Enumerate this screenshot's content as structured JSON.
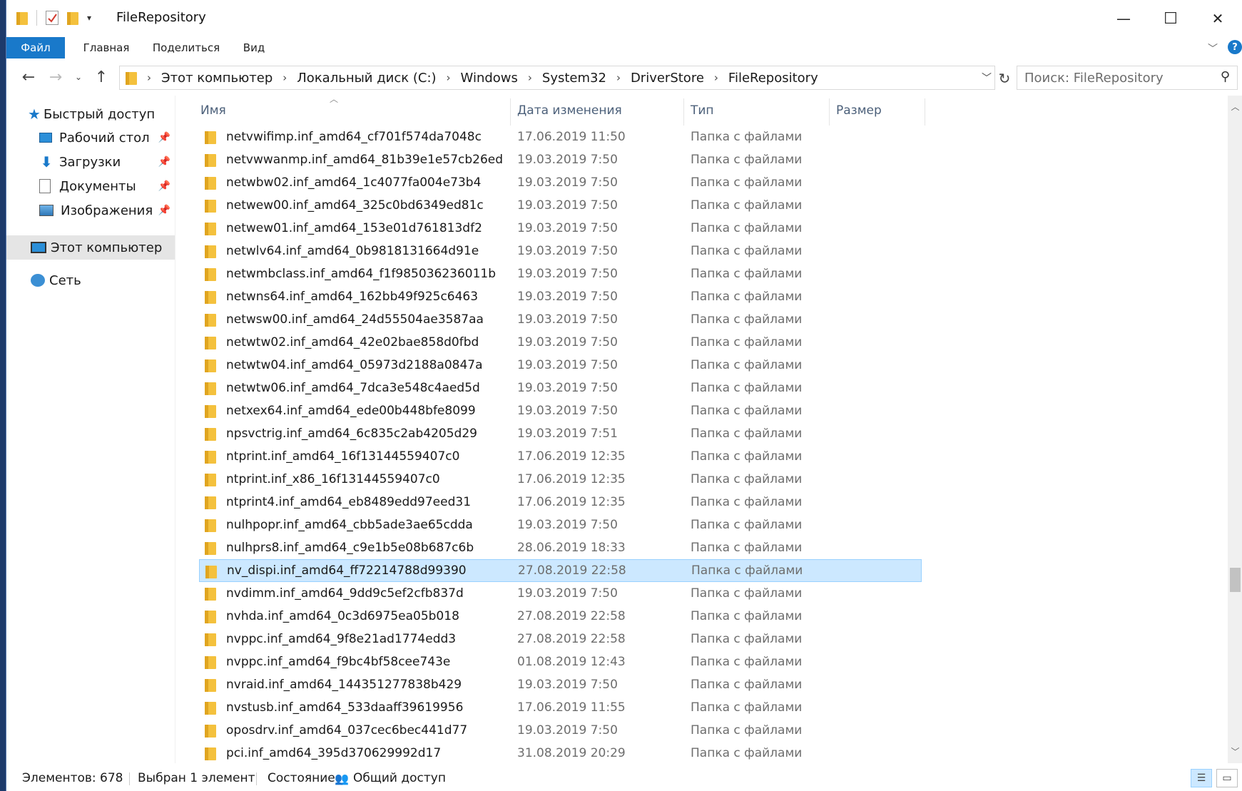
{
  "window": {
    "title": "FileRepository",
    "controls": {
      "minimize": "—",
      "maximize": "☐",
      "close": "✕"
    }
  },
  "ribbon": {
    "tabs": [
      "Файл",
      "Главная",
      "Поделиться",
      "Вид"
    ],
    "help": "?"
  },
  "address": {
    "crumbs": [
      "Этот компьютер",
      "Локальный диск (C:)",
      "Windows",
      "System32",
      "DriverStore",
      "FileRepository"
    ],
    "search_placeholder": "Поиск: FileRepository"
  },
  "nav": {
    "quick_access": "Быстрый доступ",
    "items": [
      {
        "label": "Рабочий стол",
        "icon": "desktop-icon",
        "pinned": true
      },
      {
        "label": "Загрузки",
        "icon": "downloads-icon",
        "pinned": true
      },
      {
        "label": "Документы",
        "icon": "documents-icon",
        "pinned": true
      },
      {
        "label": "Изображения",
        "icon": "pictures-icon",
        "pinned": true
      }
    ],
    "this_pc": "Этот компьютер",
    "network": "Сеть"
  },
  "columns": {
    "name": "Имя",
    "date": "Дата изменения",
    "type": "Тип",
    "size": "Размер"
  },
  "files": [
    {
      "name": "netvwifimp.inf_amd64_cf701f574da7048c",
      "date": "17.06.2019 11:50",
      "type": "Папка с файлами"
    },
    {
      "name": "netvwwanmp.inf_amd64_81b39e1e57cb26ed",
      "date": "19.03.2019 7:50",
      "type": "Папка с файлами"
    },
    {
      "name": "netwbw02.inf_amd64_1c4077fa004e73b4",
      "date": "19.03.2019 7:50",
      "type": "Папка с файлами"
    },
    {
      "name": "netwew00.inf_amd64_325c0bd6349ed81c",
      "date": "19.03.2019 7:50",
      "type": "Папка с файлами"
    },
    {
      "name": "netwew01.inf_amd64_153e01d761813df2",
      "date": "19.03.2019 7:50",
      "type": "Папка с файлами"
    },
    {
      "name": "netwlv64.inf_amd64_0b9818131664d91e",
      "date": "19.03.2019 7:50",
      "type": "Папка с файлами"
    },
    {
      "name": "netwmbclass.inf_amd64_f1f985036236011b",
      "date": "19.03.2019 7:50",
      "type": "Папка с файлами"
    },
    {
      "name": "netwns64.inf_amd64_162bb49f925c6463",
      "date": "19.03.2019 7:50",
      "type": "Папка с файлами"
    },
    {
      "name": "netwsw00.inf_amd64_24d55504ae3587aa",
      "date": "19.03.2019 7:50",
      "type": "Папка с файлами"
    },
    {
      "name": "netwtw02.inf_amd64_42e02bae858d0fbd",
      "date": "19.03.2019 7:50",
      "type": "Папка с файлами"
    },
    {
      "name": "netwtw04.inf_amd64_05973d2188a0847a",
      "date": "19.03.2019 7:50",
      "type": "Папка с файлами"
    },
    {
      "name": "netwtw06.inf_amd64_7dca3e548c4aed5d",
      "date": "19.03.2019 7:50",
      "type": "Папка с файлами"
    },
    {
      "name": "netxex64.inf_amd64_ede00b448bfe8099",
      "date": "19.03.2019 7:50",
      "type": "Папка с файлами"
    },
    {
      "name": "npsvctrig.inf_amd64_6c835c2ab4205d29",
      "date": "19.03.2019 7:51",
      "type": "Папка с файлами"
    },
    {
      "name": "ntprint.inf_amd64_16f13144559407c0",
      "date": "17.06.2019 12:35",
      "type": "Папка с файлами"
    },
    {
      "name": "ntprint.inf_x86_16f13144559407c0",
      "date": "17.06.2019 12:35",
      "type": "Папка с файлами"
    },
    {
      "name": "ntprint4.inf_amd64_eb8489edd97eed31",
      "date": "17.06.2019 12:35",
      "type": "Папка с файлами"
    },
    {
      "name": "nulhpopr.inf_amd64_cbb5ade3ae65cdda",
      "date": "19.03.2019 7:50",
      "type": "Папка с файлами"
    },
    {
      "name": "nulhprs8.inf_amd64_c9e1b5e08b687c6b",
      "date": "28.06.2019 18:33",
      "type": "Папка с файлами"
    },
    {
      "name": "nv_dispi.inf_amd64_ff72214788d99390",
      "date": "27.08.2019 22:58",
      "type": "Папка с файлами",
      "selected": true
    },
    {
      "name": "nvdimm.inf_amd64_9dd9c5ef2cfb837d",
      "date": "19.03.2019 7:50",
      "type": "Папка с файлами"
    },
    {
      "name": "nvhda.inf_amd64_0c3d6975ea05b018",
      "date": "27.08.2019 22:58",
      "type": "Папка с файлами"
    },
    {
      "name": "nvppc.inf_amd64_9f8e21ad1774edd3",
      "date": "27.08.2019 22:58",
      "type": "Папка с файлами"
    },
    {
      "name": "nvppc.inf_amd64_f9bc4bf58cee743e",
      "date": "01.08.2019 12:43",
      "type": "Папка с файлами"
    },
    {
      "name": "nvraid.inf_amd64_144351277838b429",
      "date": "19.03.2019 7:50",
      "type": "Папка с файлами"
    },
    {
      "name": "nvstusb.inf_amd64_533daaff39619956",
      "date": "17.06.2019 11:55",
      "type": "Папка с файлами"
    },
    {
      "name": "oposdrv.inf_amd64_037cec6bec441d77",
      "date": "19.03.2019 7:50",
      "type": "Папка с файлами"
    },
    {
      "name": "pci.inf_amd64_395d370629992d17",
      "date": "31.08.2019 20:29",
      "type": "Папка с файлами"
    }
  ],
  "status": {
    "count": "Элементов: 678",
    "selected": "Выбран 1 элемент",
    "state": "Состояние:",
    "sharing": "Общий доступ"
  },
  "colors": {
    "accent": "#1979ca",
    "selection": "#cce8ff",
    "folder": "#f4c13d"
  }
}
